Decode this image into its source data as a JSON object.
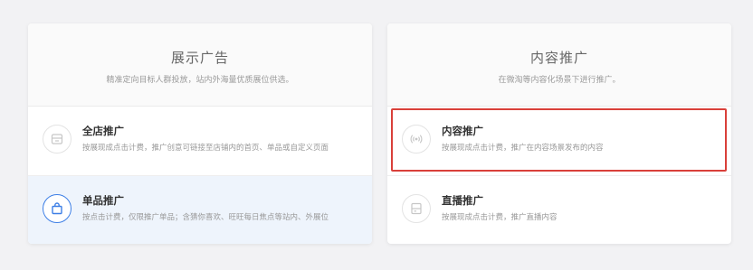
{
  "display_ads": {
    "title": "展示广告",
    "subtitle": "精准定向目标人群投放，站内外海量优质展位供选。",
    "options": [
      {
        "title": "全店推广",
        "description": "按展现成点击计费，推广创意可链接至店铺内的首页、单品或自定义页面",
        "icon": "store-icon"
      },
      {
        "title": "单品推广",
        "description": "按点击计费，仅限推广单品；含猜你喜欢、旺旺每日焦点等站内、外展位",
        "icon": "shopping-bag-icon",
        "selected": true
      }
    ]
  },
  "content_promo": {
    "title": "内容推广",
    "subtitle": "在微淘等内容化场景下进行推广。",
    "options": [
      {
        "title": "内容推广",
        "description": "按展现成点击计费，推广在内容场景发布的内容",
        "icon": "broadcast-icon",
        "highlighted": true
      },
      {
        "title": "直播推广",
        "description": "按展现成点击计费，推广直播内容",
        "icon": "live-screen-icon"
      }
    ]
  },
  "colors": {
    "accent_blue": "#3d7fe6",
    "highlight_red": "#d9403a",
    "selected_bg": "#eef4fc"
  }
}
